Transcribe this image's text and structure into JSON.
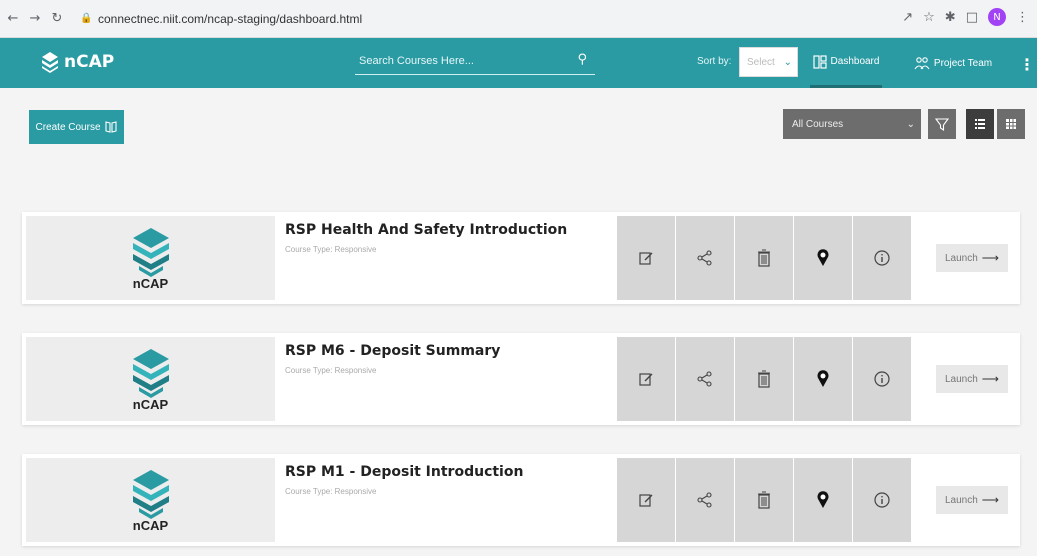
{
  "browser": {
    "back_icon": "arrow-left-icon",
    "forward_icon": "arrow-right-icon",
    "reload_icon": "reload-icon",
    "url": "connectnec.niit.com/ncap-staging/dashboard.html",
    "profile_initial": "N"
  },
  "header": {
    "logo_text": "nCAP",
    "search_placeholder": "Search Courses Here...",
    "sort_label": "Sort by:",
    "sort_value": "Select",
    "nav_dashboard": "Dashboard",
    "nav_project_team": "Project Team",
    "brand_color": "#2a9aa3"
  },
  "toolbar": {
    "create_course_label": "Create Course",
    "filter_value": "All Courses"
  },
  "courses": [
    {
      "title": "RSP Health And Safety Introduction",
      "type": "Course Type: Responsive",
      "thumb_label": "nCAP",
      "launch_label": "Launch"
    },
    {
      "title": "RSP M6 - Deposit Summary",
      "type": "Course Type: Responsive",
      "thumb_label": "nCAP",
      "launch_label": "Launch"
    },
    {
      "title": "RSP M1 - Deposit Introduction",
      "type": "Course Type: Responsive",
      "thumb_label": "nCAP",
      "launch_label": "Launch"
    }
  ]
}
